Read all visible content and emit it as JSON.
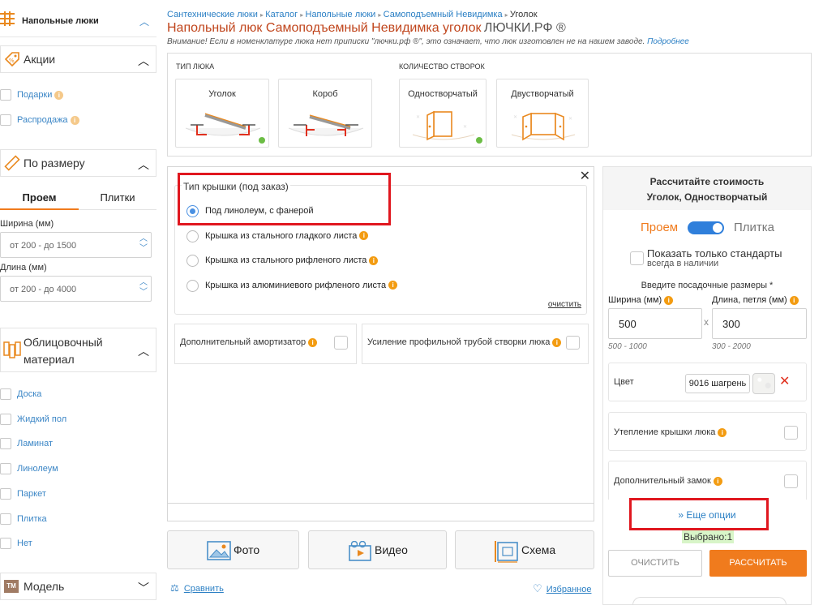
{
  "sidebar": {
    "top_title": "Напольные люки",
    "sections": {
      "promo": {
        "title": "Акции",
        "items": [
          {
            "label": "Подарки"
          },
          {
            "label": "Распродажа"
          }
        ]
      },
      "size": {
        "title": "По размеру",
        "tabs": [
          "Проем",
          "Плитки"
        ],
        "width_label": "Ширина (мм)",
        "width_placeholder": "от 200 - до 1500",
        "length_label": "Длина (мм)",
        "length_placeholder": "от 200 - до 4000"
      },
      "facing": {
        "title": "Облицовочный материал",
        "title_line1": "Облицовочный",
        "title_line2": "материал",
        "items": [
          "Доска",
          "Жидкий пол",
          "Ламинат",
          "Линолеум",
          "Паркет",
          "Плитка",
          "Нет"
        ]
      },
      "model": {
        "title": "Модель",
        "icon_text": "TM"
      }
    }
  },
  "breadcrumb": [
    "Сантехнические люки",
    "Каталог",
    "Напольные люки",
    "Самоподъемный Невидимка",
    "Уголок"
  ],
  "page_title": "Напольный люк Самоподъемный Невидимка уголок",
  "brand": "ЛЮЧКИ.РФ ®",
  "notice": {
    "text": "Внимание! Если в номенклатуре люка нет приписки \"лючки.рф ®\", это означает, что люк изготовлен не на нашем заводе.",
    "link": "Подробнее"
  },
  "type_panel": {
    "type_title": "ТИП ЛЮКА",
    "type_cards": [
      "Уголок",
      "Короб"
    ],
    "doors_title": "КОЛИЧЕСТВО СТВОРОК",
    "door_cards": [
      "Одностворчатый",
      "Двустворчатый"
    ]
  },
  "options_popup": {
    "lid_title": "Тип крышки (под заказ)",
    "lid_options": [
      "Под линолеум, с фанерой",
      "Крышка из стального гладкого листа",
      "Крышка из стального рифленого листа",
      "Крышка из алюминиевого рифленого листа"
    ],
    "clear_label": "очистить",
    "extras": [
      "Дополнительный амортизатор",
      "Усиление профильной трубой створки люка"
    ]
  },
  "media_buttons": [
    "Фото",
    "Видео",
    "Схема"
  ],
  "bottom_links": {
    "compare": "Сравнить",
    "favorites": "Избранное"
  },
  "calculator": {
    "title_line1": "Рассчитайте стоимость",
    "title_line2": "Уголок, Одностворчатый",
    "toggle_left": "Проем",
    "toggle_right": "Плитка",
    "standards_label": "Показать только стандарты",
    "standards_sub": "всегда в наличии",
    "sizes_title": "Введите посадочные размеры *",
    "width_label": "Ширина (мм)",
    "length_label": "Длина, петля (мм)",
    "width_value": "500",
    "length_value": "300",
    "times_sign": "x",
    "width_range": "500 - 1000",
    "length_range": "300 - 2000",
    "color_label": "Цвет",
    "color_value": "9016 шагрень",
    "options": [
      "Утепление крышки люка",
      "Дополнительный замок"
    ],
    "more_options": "Еще опции",
    "more_options_arrow": "»",
    "selected": "Выбрано:1",
    "clear_button": "ОЧИСТИТЬ",
    "calc_button": "РАССЧИТАТЬ"
  },
  "colors": {
    "title_orange": "#c0451c",
    "link_blue": "#2a7fc4",
    "accent_orange": "#f07b1d",
    "toggle_blue": "#2f7fdb",
    "annotation_red": "#e0171f",
    "selected_green_bg": "#d8f5c8"
  }
}
